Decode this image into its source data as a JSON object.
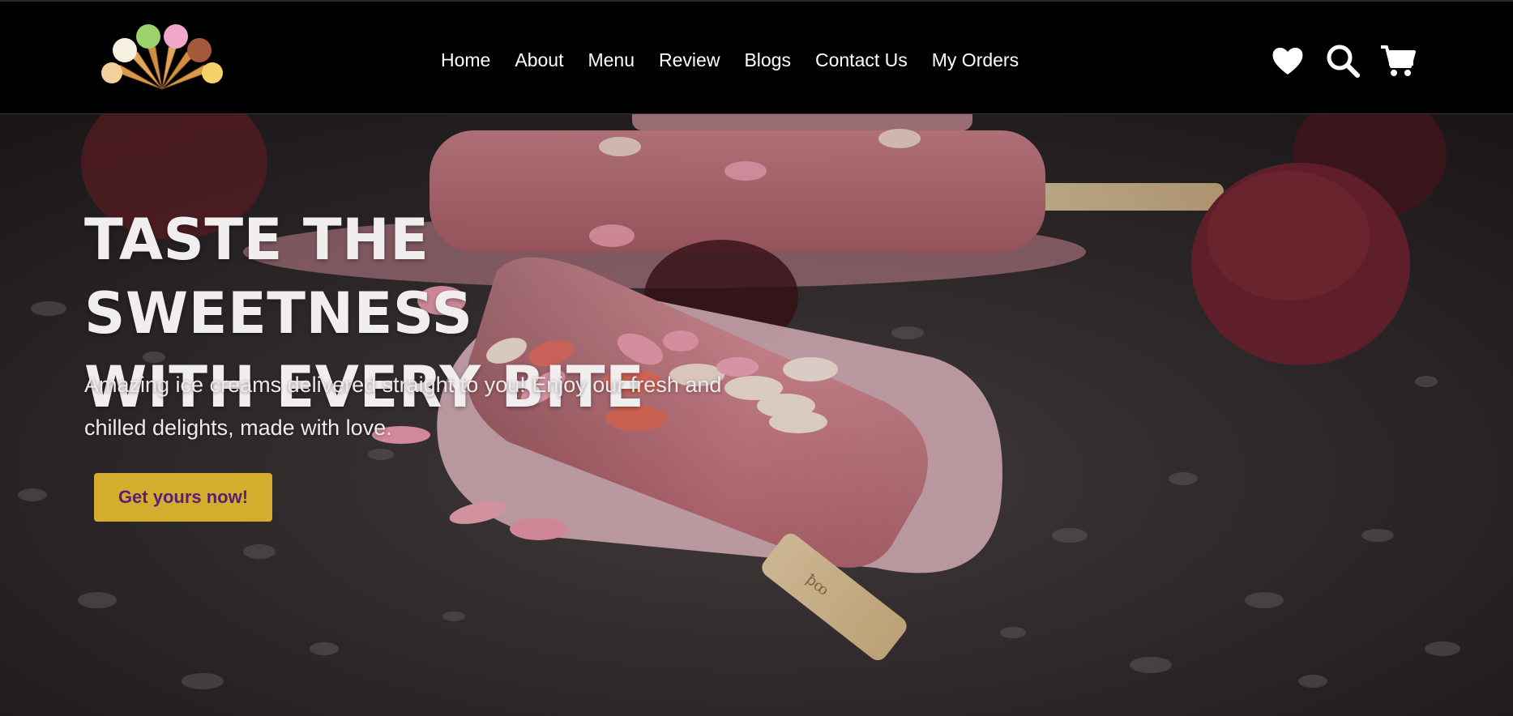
{
  "brand": {
    "logo_icon": "ice-cream-cones-fan-logo"
  },
  "nav": {
    "items": [
      {
        "label": "Home"
      },
      {
        "label": "About"
      },
      {
        "label": "Menu"
      },
      {
        "label": "Review"
      },
      {
        "label": "Blogs"
      },
      {
        "label": "Contact Us"
      },
      {
        "label": "My Orders"
      }
    ]
  },
  "header_icons": [
    "heart-icon",
    "search-icon",
    "cart-icon"
  ],
  "hero": {
    "title_line1": "TASTE THE SWEETNESS",
    "title_line2": "WITH EVERY BITE",
    "subtitle_line1": "Amazing ice creams delivered straight to you! Enjoy our fresh and",
    "subtitle_line2": "chilled delights, made with love.",
    "cta_label": "Get yours now!"
  },
  "colors": {
    "header_bg": "#000000",
    "nav_text": "#ffffff",
    "cta_bg": "#d4ad2f",
    "cta_text": "#5a1f74",
    "hero_text": "#f1eeef"
  }
}
